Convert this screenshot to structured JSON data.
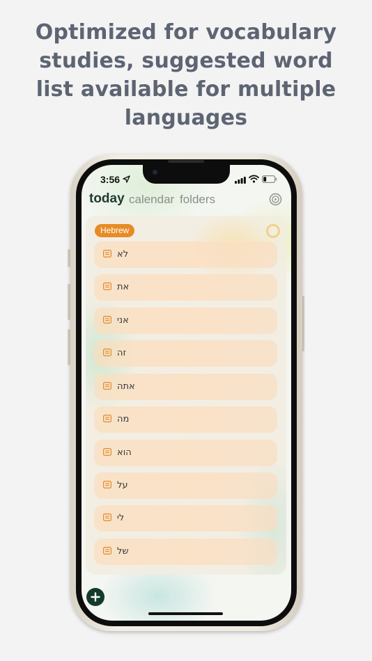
{
  "headline": {
    "lines": [
      "Optimized for vocabulary",
      "studies, suggested word",
      "list available for multiple",
      "languages"
    ]
  },
  "status_bar": {
    "time": "3:56"
  },
  "nav": {
    "tabs": [
      {
        "label": "today",
        "active": true
      },
      {
        "label": "calendar",
        "active": false
      },
      {
        "label": "folders",
        "active": false
      }
    ]
  },
  "group": {
    "label": "Hebrew",
    "items": [
      {
        "text": "לא"
      },
      {
        "text": "את"
      },
      {
        "text": "אני"
      },
      {
        "text": "זה"
      },
      {
        "text": "אתה"
      },
      {
        "text": "מה"
      },
      {
        "text": "הוא"
      },
      {
        "text": "על"
      },
      {
        "text": "לי"
      },
      {
        "text": "של"
      }
    ]
  },
  "colors": {
    "headline": "#5d6472",
    "badge": "#e88b26",
    "accent_dark_green": "#143a2c",
    "row_background": "#fbe0c4"
  }
}
